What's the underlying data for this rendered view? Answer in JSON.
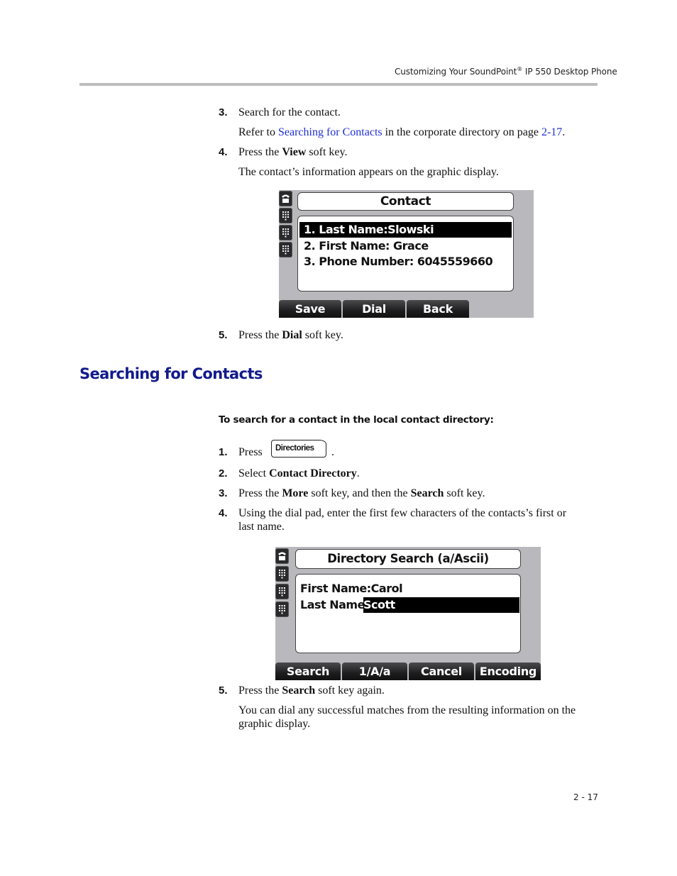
{
  "header": {
    "running_title_pre": "Customizing Your SoundPoint",
    "registered_mark": "®",
    "running_title_post": " IP 550 Desktop Phone"
  },
  "section1_steps": [
    {
      "num": "3.",
      "text": "Search for the contact."
    },
    {
      "note_pre": "Refer to ",
      "note_link": "Searching for Contacts",
      "note_mid": " in the corporate directory on page ",
      "note_page_link": "2-17",
      "note_post": "."
    },
    {
      "num": "4.",
      "text_pre": "Press the ",
      "bold": "View",
      "text_post": " soft key."
    },
    {
      "note": "The contact’s information appears on the graphic display."
    },
    {
      "num": "5.",
      "text_pre": "Press the ",
      "bold": "Dial",
      "text_post": " soft key."
    }
  ],
  "contact_screen": {
    "title": "Contact",
    "rows": [
      "1. Last Name:Slowski",
      "2. First Name: Grace",
      "3. Phone Number: 6045559660"
    ],
    "selected_row": 0,
    "softkeys": [
      "Save",
      "Dial",
      "Back"
    ],
    "line_key_icons": [
      "handset-icon",
      "keypad-icon",
      "keypad-icon",
      "keypad-icon"
    ]
  },
  "section_heading": "Searching for Contacts",
  "procedure_heading": "To search for a contact in the local contact directory:",
  "section2_steps": [
    {
      "num": "1.",
      "text": "Press",
      "key_label": "Directories",
      "after": "."
    },
    {
      "num": "2.",
      "text_pre": "Select ",
      "bold": "Contact Directory",
      "text_post": "."
    },
    {
      "num": "3.",
      "text_pre": "Press the ",
      "bold": "More",
      "text_mid": " soft key, and then the ",
      "bold2": "Search",
      "text_post": " soft key."
    },
    {
      "num": "4.",
      "line1": "Using the dial pad, enter the first few characters of the contacts’s first or",
      "line2": "last name."
    },
    {
      "num": "5.",
      "text_pre": "Press the ",
      "bold": "Search",
      "text_post": " soft key again."
    },
    {
      "note_line1": "You can dial any successful matches from the resulting information on the",
      "note_line2": "graphic display."
    }
  ],
  "search_screen": {
    "title": "Directory Search (a/Ascii)",
    "first_name_label": "First Name:",
    "first_name_value": "Carol",
    "last_name_label": "Last Name:",
    "last_name_value": "Scott",
    "softkeys": [
      "Search",
      "1/A/a",
      "Cancel",
      "Encoding"
    ]
  },
  "footer": {
    "page_number": "2 - 17"
  },
  "colors": {
    "link": "#1f2fd6",
    "heading": "#121a8c",
    "screen_bg": "#b9b8bd",
    "rule": "#bdbdbd"
  }
}
